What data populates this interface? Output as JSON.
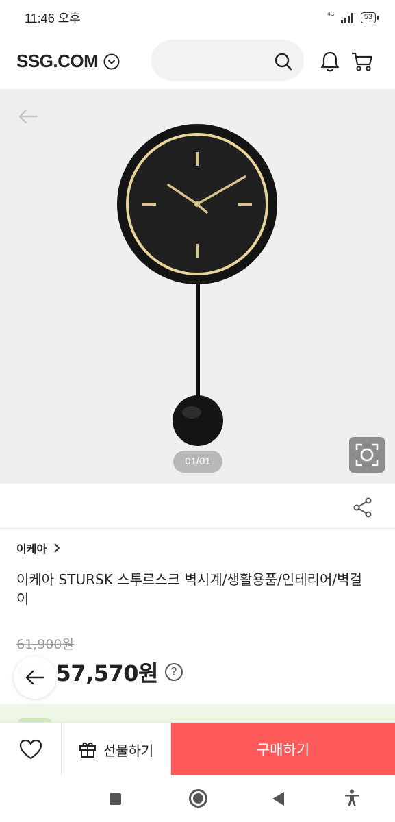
{
  "status_bar": {
    "time": "11:46 오후",
    "network": "4G",
    "battery": "53"
  },
  "header": {
    "logo": "SSG.COM",
    "icons": [
      "chevron-down-icon",
      "search-icon",
      "bell-icon",
      "cart-icon"
    ]
  },
  "gallery": {
    "counter": "01/01",
    "icons": [
      "back-arrow-icon",
      "lens-search-icon"
    ]
  },
  "share": {
    "icon": "share-icon"
  },
  "product": {
    "brand": "이케아",
    "title": "이케아 STURSK 스투르스크 벽시계/생활용품/인테리어/벽걸이",
    "original_price": "61,900원",
    "discount": "6%",
    "price": "57,570원",
    "help": "?"
  },
  "actions": {
    "gift_label": "선물하기",
    "buy_label": "구매하기",
    "like_icon": "heart-icon",
    "gift_icon": "gift-icon"
  },
  "colors": {
    "accent": "#ff5a5a",
    "image_bg": "#efefef",
    "clock_gold": "#d9c48c"
  }
}
